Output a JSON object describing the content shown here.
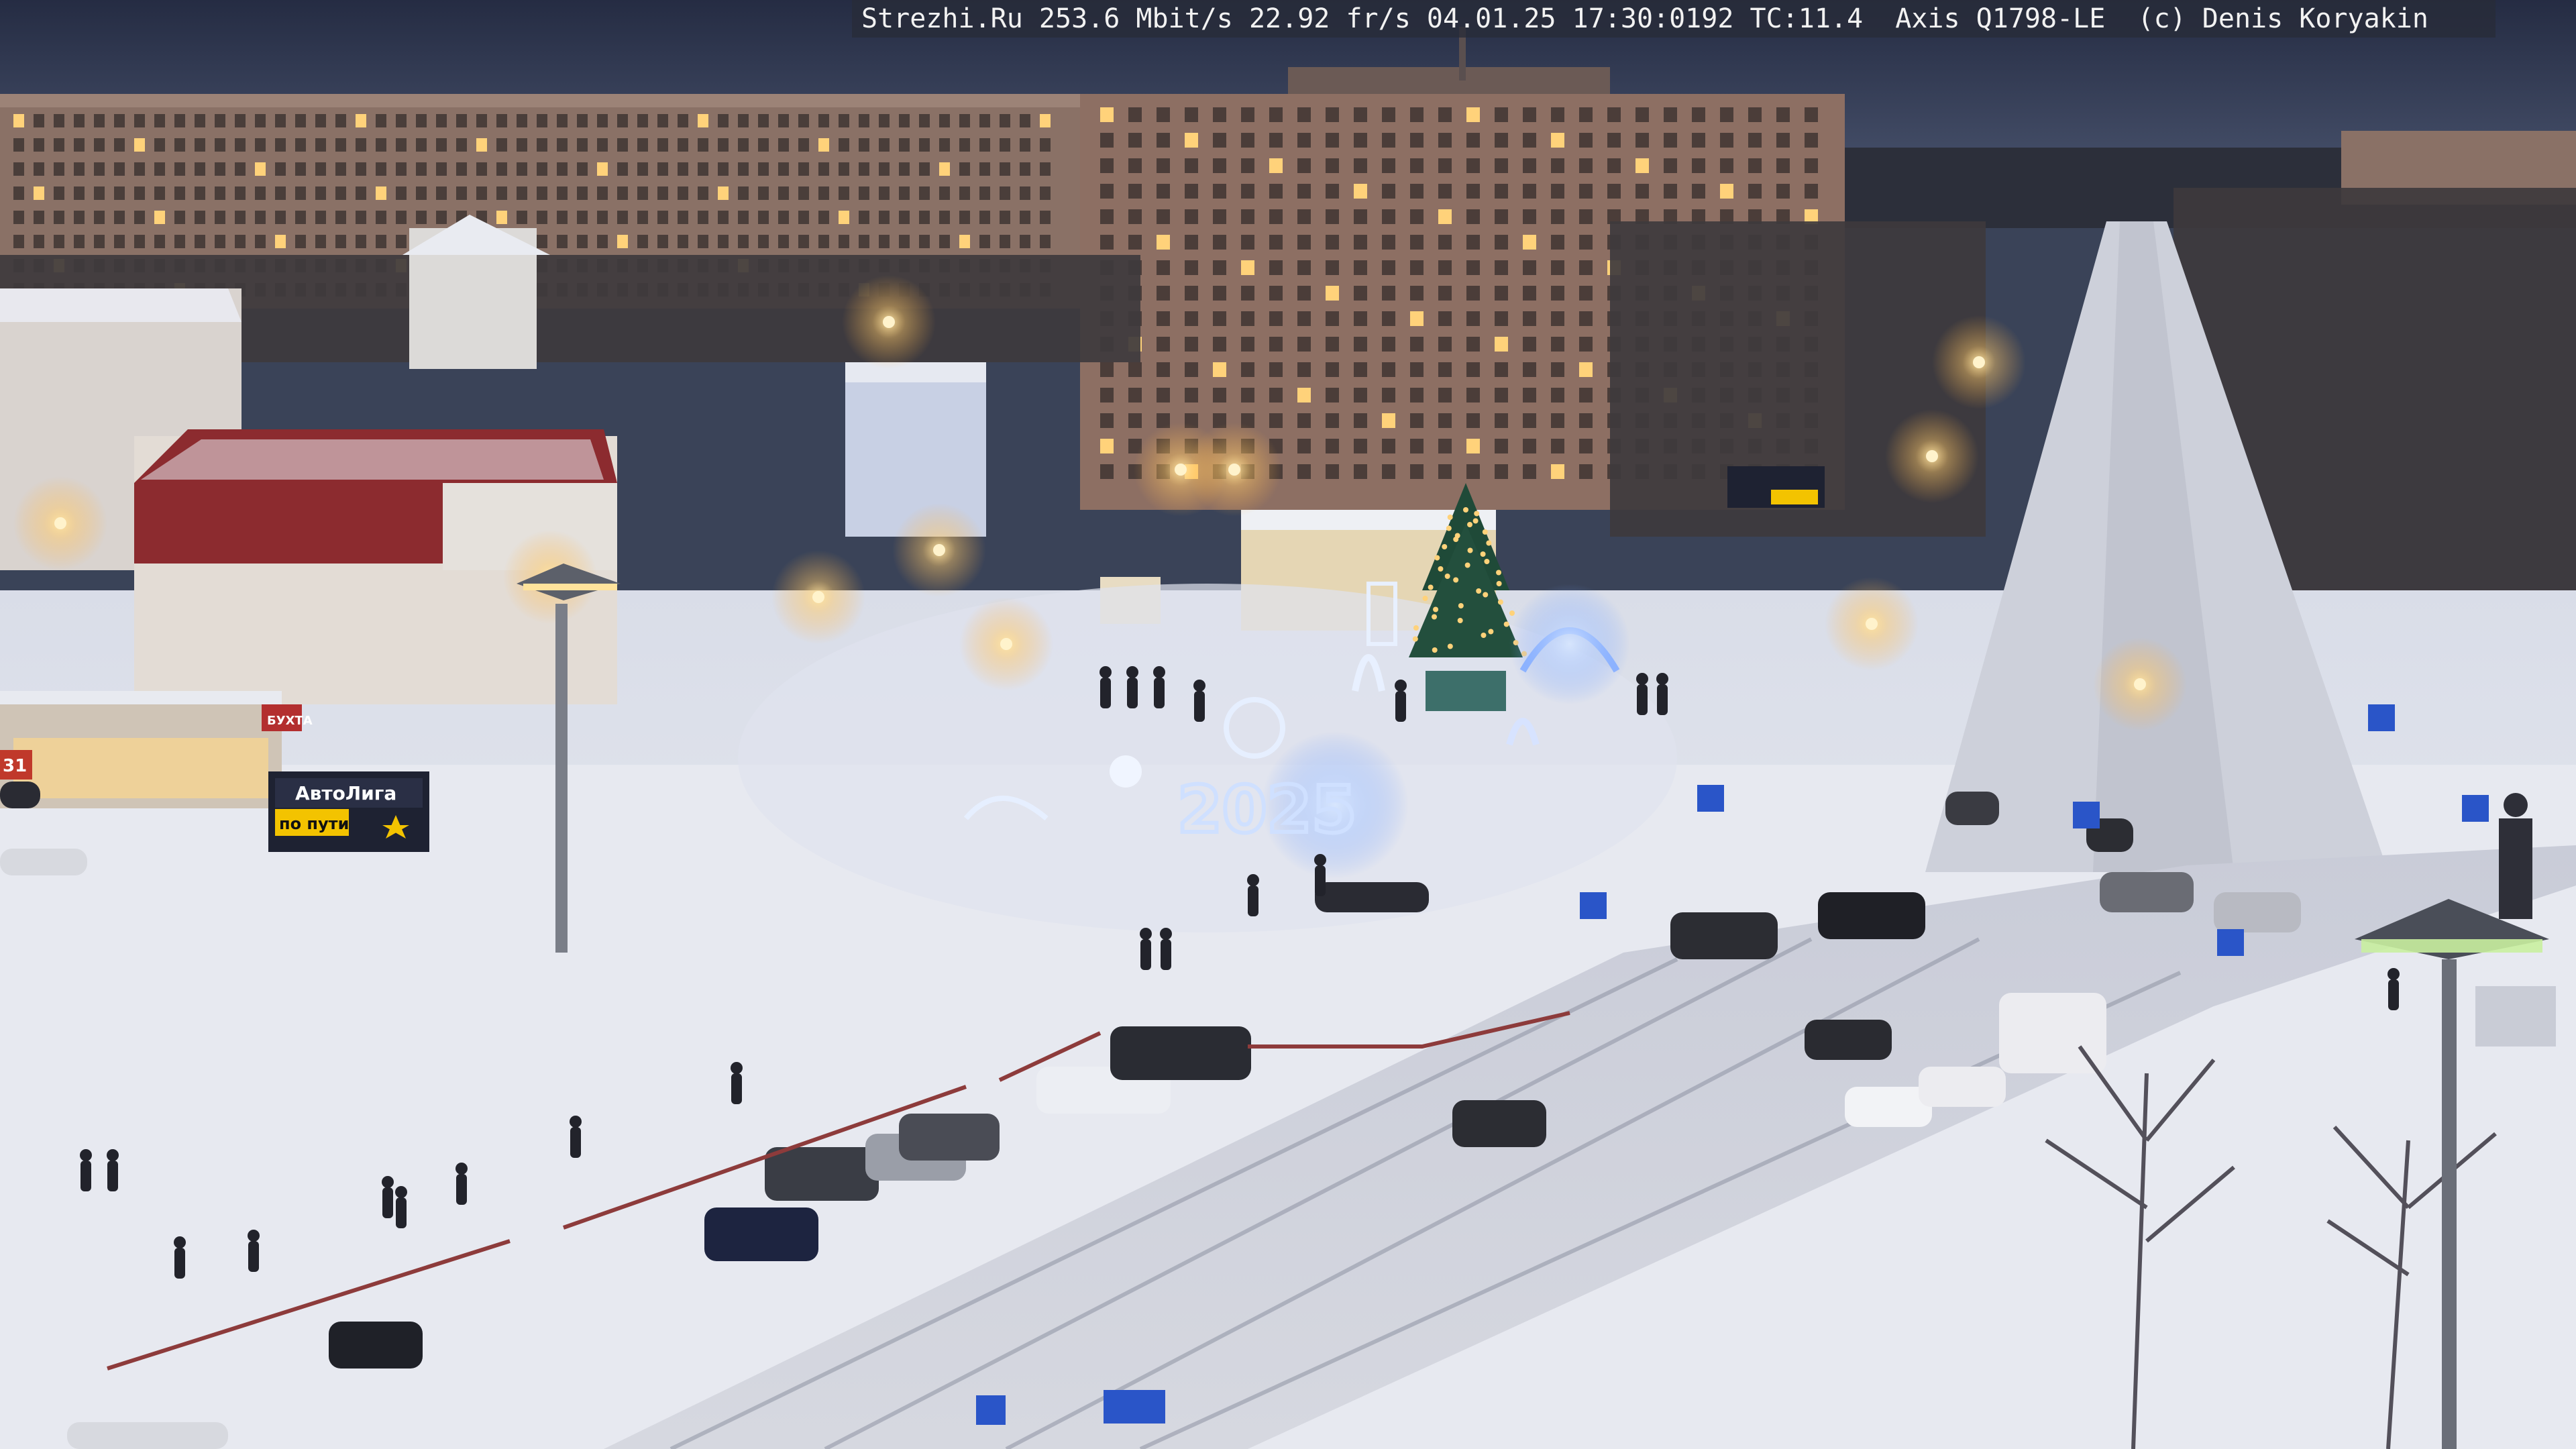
{
  "overlay": {
    "caption": "Strezhi.Ru 253.6 Mbit/s 22.92 fr/s 04.01.25 17:30:0192 TC:11.4  Axis Q1798-LE  (c) Denis Koryakin"
  },
  "scene": {
    "sky_color": "#2d3650",
    "snow_color": "#e4e7ef",
    "light_color": "#ffd27a",
    "decor_color": "#7fb0ff",
    "led_year": "2025",
    "billboard_brand": "АвтоЛига",
    "billboard_tagline": "по пути",
    "shop_sign": "БУХТА",
    "store_number": "31"
  }
}
